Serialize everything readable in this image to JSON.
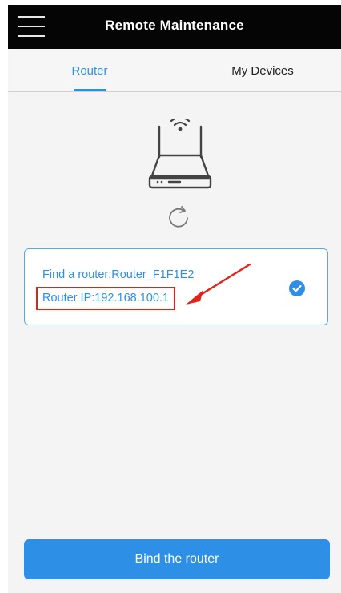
{
  "header": {
    "title": "Remote Maintenance",
    "menu_icon": "hamburger-menu-icon"
  },
  "tabs": [
    {
      "label": "Router",
      "active": true
    },
    {
      "label": "My Devices",
      "active": false
    }
  ],
  "colors": {
    "accent": "#2e8fe6",
    "header_bg": "#050505",
    "highlight_red": "#e2231a"
  },
  "main": {
    "illustration_icon": "wifi-router-icon",
    "refresh_icon": "refresh-icon",
    "router_card": {
      "find_text": "Find a router:Router_F1F1E2",
      "ip_text": "Router IP:192.168.100.1",
      "selected": true,
      "check_icon": "check-circle-icon"
    }
  },
  "footer": {
    "bind_button_label": "Bind the router"
  }
}
